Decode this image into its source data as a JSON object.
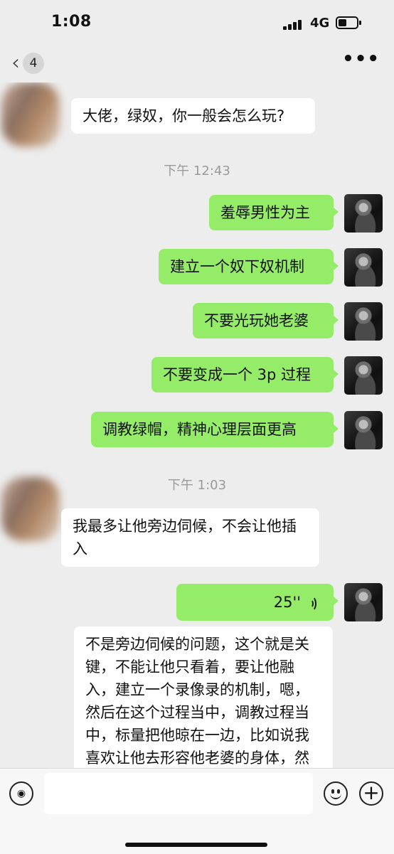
{
  "status": {
    "time": "1:08",
    "network": "4G"
  },
  "nav": {
    "back_count": "4",
    "more": "•••"
  },
  "timestamps": [
    "下午 12:43",
    "下午 1:03"
  ],
  "messages": [
    {
      "side": "in",
      "text": "大佬，绿奴，你一般会怎么玩?"
    },
    {
      "side": "out",
      "text": "羞辱男性为主"
    },
    {
      "side": "out",
      "text": "建立一个奴下奴机制"
    },
    {
      "side": "out",
      "text": "不要光玩她老婆"
    },
    {
      "side": "out",
      "text": "不要变成一个 3p 过程"
    },
    {
      "side": "out",
      "text": "调教绿帽，精神心理层面更高"
    },
    {
      "side": "in",
      "text": "我最多让他旁边伺候，不会让他插入"
    },
    {
      "side": "out",
      "type": "voice",
      "duration": "25''"
    },
    {
      "side": "in",
      "text": "不是旁边伺候的问题，这个就是关键，不能让他只看着，要让他融入，建立一个录像录的机制，嗯，然后在这个过程当中，调教过程当中，标量把他晾在一边，比如说我喜欢让他去形容他老婆的身体，然后让他建议我…"
    }
  ],
  "input": {
    "placeholder": ""
  }
}
